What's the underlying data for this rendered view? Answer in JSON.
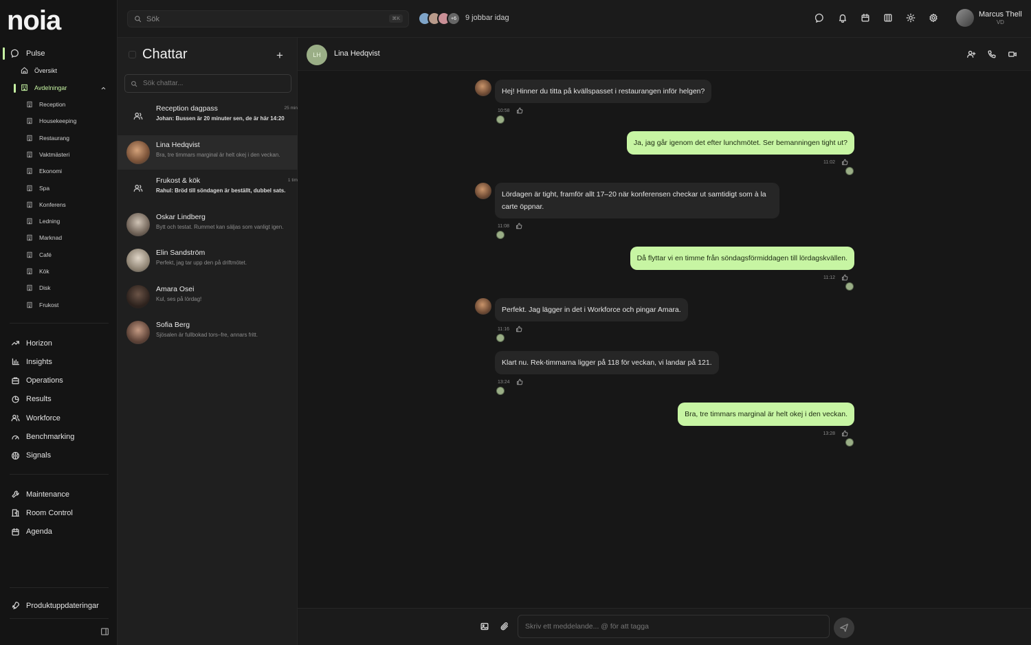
{
  "brand": {
    "logo": "noia"
  },
  "sidebar": {
    "pulse": "Pulse",
    "overview": "Översikt",
    "departments": "Avdelningar",
    "dept_items": [
      "Reception",
      "Housekeeping",
      "Restaurang",
      "Vaktmästeri",
      "Ekonomi",
      "Spa",
      "Konferens",
      "Ledning",
      "Marknad",
      "Café",
      "Kök",
      "Disk",
      "Frukost"
    ],
    "modules": [
      "Horizon",
      "Insights",
      "Operations",
      "Results",
      "Workforce",
      "Benchmarking",
      "Signals"
    ],
    "tools": [
      "Maintenance",
      "Room Control",
      "Agenda"
    ],
    "updates": "Produktuppdateringar",
    "accent": "#c7f5a3"
  },
  "topbar": {
    "search_placeholder": "Sök",
    "shortcut": "⌘K",
    "extra_count": "+6",
    "working_today": "9 jobbar idag",
    "user_name": "Marcus Thell",
    "user_role": "VD"
  },
  "chatlist": {
    "title": "Chattar",
    "add": "+",
    "search_placeholder": "Sök chattar...",
    "conversations": [
      {
        "name": "Reception dagpass",
        "preview": "Johan: Bussen är 20 minuter sen, de är här 14:20",
        "time": "25 min",
        "group": true,
        "unread": true
      },
      {
        "name": "Lina Hedqvist",
        "preview": "Bra, tre timmars marginal är helt okej i den veckan.",
        "time": "",
        "group": false,
        "active": true
      },
      {
        "name": "Frukost & kök",
        "preview": "Rahul: Bröd till söndagen är beställt, dubbel sats.",
        "time": "1 tim",
        "group": true,
        "unread": true
      },
      {
        "name": "Oskar Lindberg",
        "preview": "Bytt och testat. Rummet kan säljas som vanligt igen.",
        "time": "",
        "group": false
      },
      {
        "name": "Elin Sandström",
        "preview": "Perfekt, jag tar upp den på driftmötet.",
        "time": "",
        "group": false
      },
      {
        "name": "Amara Osei",
        "preview": "Kul, ses på lördag!",
        "time": "",
        "group": false
      },
      {
        "name": "Sofia Berg",
        "preview": "Sjösalen är fullbokad tors–fre, annars fritt.",
        "time": "",
        "group": false
      }
    ]
  },
  "chat": {
    "contact_initials": "LH",
    "contact_name": "Lina Hedqvist",
    "messages": [
      {
        "dir": "in",
        "text": "Hej! Hinner du titta på kvällspasset i restaurangen inför helgen?",
        "time": "10:58",
        "seen": "LH"
      },
      {
        "dir": "out",
        "text": "Ja, jag går igenom det efter lunchmötet. Ser bemanningen tight ut?",
        "time": "11:02",
        "seen": "MT"
      },
      {
        "dir": "in",
        "text": "Lördagen är tight, framför allt 17–20 när konferensen checkar ut samtidigt som à la carte öppnar.",
        "time": "11:08",
        "seen": "LH"
      },
      {
        "dir": "out",
        "text": "Då flyttar vi en timme från söndagsförmiddagen till lördagskvällen.",
        "time": "11:12",
        "seen": "MT"
      },
      {
        "dir": "in",
        "text": "Perfekt. Jag lägger in det i Workforce och pingar Amara.",
        "time": "11:16",
        "seen": "LH"
      },
      {
        "dir": "in",
        "text": "Klart nu. Rek-timmarna ligger på 118 för veckan, vi landar på 121.",
        "time": "13:24",
        "seen": "LH"
      },
      {
        "dir": "out",
        "text": "Bra, tre timmars marginal är helt okej i den veckan.",
        "time": "13:28",
        "seen": "MT"
      }
    ],
    "composer_placeholder": "Skriv ett meddelande... @ för att tagga"
  }
}
